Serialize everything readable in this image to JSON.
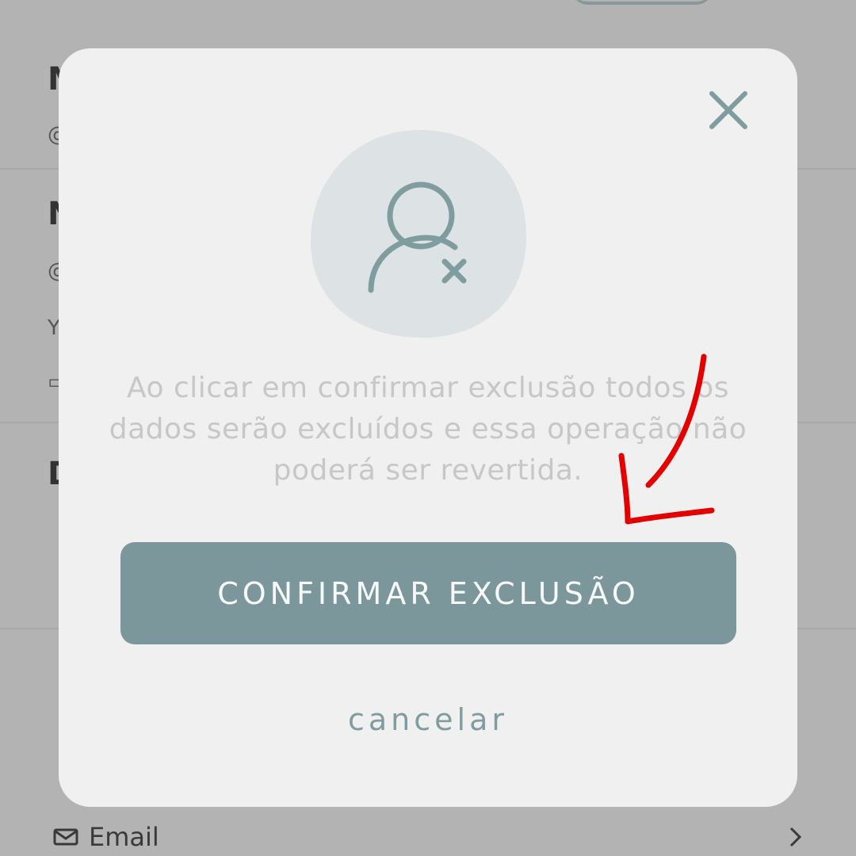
{
  "background": {
    "email_row": {
      "label": "Email",
      "icon": "mail-icon",
      "trailing_icon": "chevron-right-icon"
    }
  },
  "modal": {
    "close_icon": "close-icon",
    "illustration_icon": "user-remove-icon",
    "message": "Ao clicar em confirmar exclusão todos os dados serão excluídos e essa operação não poderá ser revertida.",
    "confirm_label": "CONFIRMAR EXCLUSÃO",
    "cancel_label": "cancelar"
  },
  "colors": {
    "accent": "#7c979b",
    "overlay": "#b3b3b3",
    "modal_bg": "#f0f0f0",
    "blob": "#dde2e4",
    "icon": "#7f9c9e",
    "annotation": "#e50000"
  },
  "annotation": {
    "shape": "red hand-drawn arrow pointing to confirm button"
  }
}
